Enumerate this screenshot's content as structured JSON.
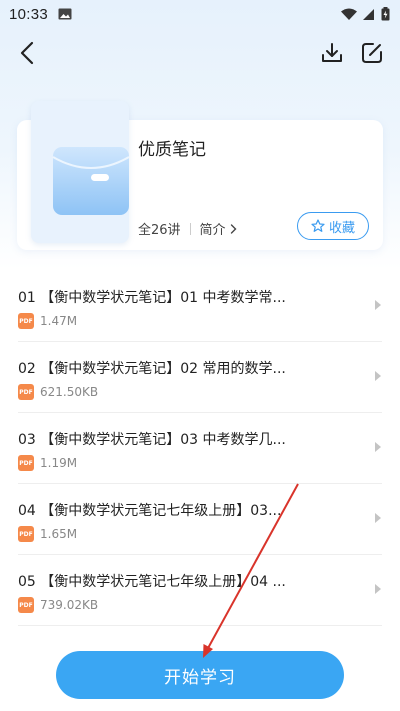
{
  "status_bar": {
    "time": "10:33"
  },
  "collection": {
    "title": "优质笔记",
    "count": "全26讲",
    "intro_label": "简介",
    "collect_label": "收藏"
  },
  "items": [
    {
      "title": "01 【衡中数学状元笔记】01 中考数学常...",
      "size": "1.47M",
      "badge": "PDF"
    },
    {
      "title": "02 【衡中数学状元笔记】02 常用的数学...",
      "size": "621.50KB",
      "badge": "PDF"
    },
    {
      "title": "03 【衡中数学状元笔记】03 中考数学几...",
      "size": "1.19M",
      "badge": "PDF"
    },
    {
      "title": "04 【衡中数学状元笔记七年级上册】03...",
      "size": "1.65M",
      "badge": "PDF"
    },
    {
      "title": "05 【衡中数学状元笔记七年级上册】04 ...",
      "size": "739.02KB",
      "badge": "PDF"
    }
  ],
  "start_button": {
    "label": "开始学习"
  },
  "colors": {
    "accent": "#3aa6f3",
    "pdf_badge": "#f5894a",
    "annotation_arrow": "#d9342b"
  }
}
